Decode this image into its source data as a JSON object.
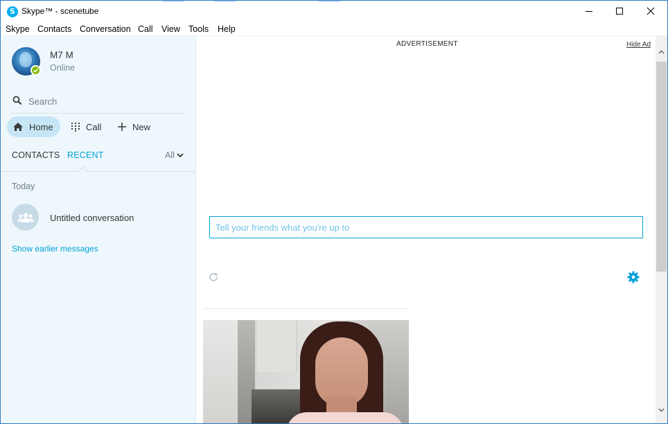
{
  "window": {
    "title": "Skype™ - scenetube",
    "app_logo_glyph": "S"
  },
  "menu": [
    "Skype",
    "Contacts",
    "Conversation",
    "Call",
    "View",
    "Tools",
    "Help"
  ],
  "profile": {
    "name": "M7 M",
    "status": "Online",
    "status_color": "#7fba00"
  },
  "search": {
    "placeholder": "Search"
  },
  "nav": {
    "home": "Home",
    "call": "Call",
    "new": "New"
  },
  "tabs": {
    "contacts": "CONTACTS",
    "recent": "RECENT",
    "filter": "All"
  },
  "recent": {
    "section": "Today",
    "conversations": [
      {
        "title": "Untitled conversation"
      }
    ],
    "show_earlier": "Show earlier messages"
  },
  "main": {
    "ad_label": "ADVERTISEMENT",
    "hide_ad": "Hide Ad",
    "mood_placeholder": "Tell your friends what you're up to"
  },
  "colors": {
    "accent": "#00a2d9",
    "sidebar_bg": "#eef7fc",
    "home_pill": "#c6e6f6"
  },
  "icons": {
    "window": [
      "skype-logo-icon",
      "minimize-icon",
      "maximize-icon",
      "close-icon"
    ],
    "sidebar": [
      "search-icon",
      "home-icon",
      "dialpad-icon",
      "plus-icon",
      "chevron-down-icon",
      "group-icon",
      "checkmark-icon"
    ],
    "main": [
      "refresh-icon",
      "gear-icon",
      "scroll-up-icon",
      "scroll-down-icon"
    ]
  }
}
